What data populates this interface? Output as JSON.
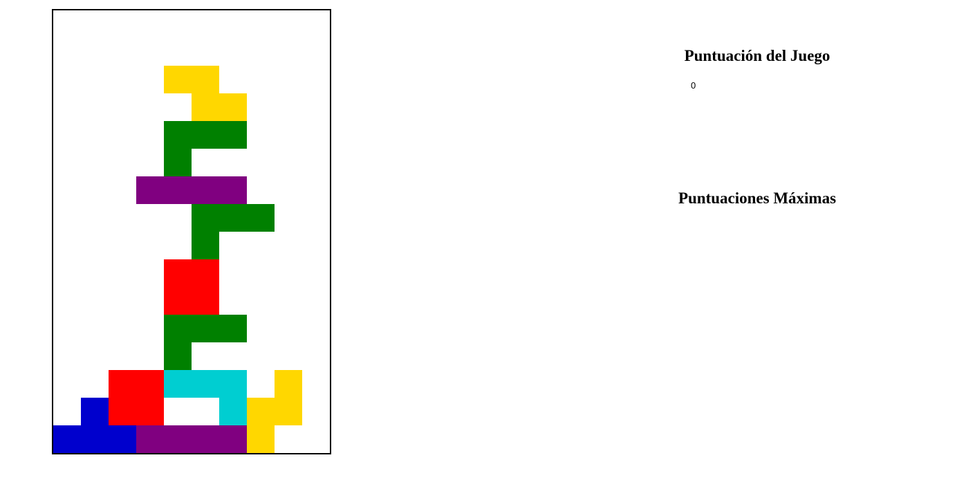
{
  "game": {
    "board_cols": 10,
    "board_rows": 16,
    "colors": {
      "Y": "#ffd700",
      "G": "#008000",
      "P": "#800080",
      "R": "#ff0000",
      "C": "#00ced1",
      "B": "#0000cd"
    },
    "grid": [
      "..........",
      "..........",
      "....YY....",
      ".....YY...",
      "....GGG...",
      "....G.....",
      "...PPPP...",
      ".....GGG..",
      ".....G....",
      "....RR....",
      "....RR....",
      "....GGG...",
      "....G.....",
      "..RRCCC.Y.",
      ".BRR..CYY.",
      "BBBPPPPY.."
    ]
  },
  "score_panel": {
    "title": "Puntuación del Juego",
    "value": "0"
  },
  "high_scores": {
    "title": "Puntuaciones Máximas",
    "entries": []
  }
}
